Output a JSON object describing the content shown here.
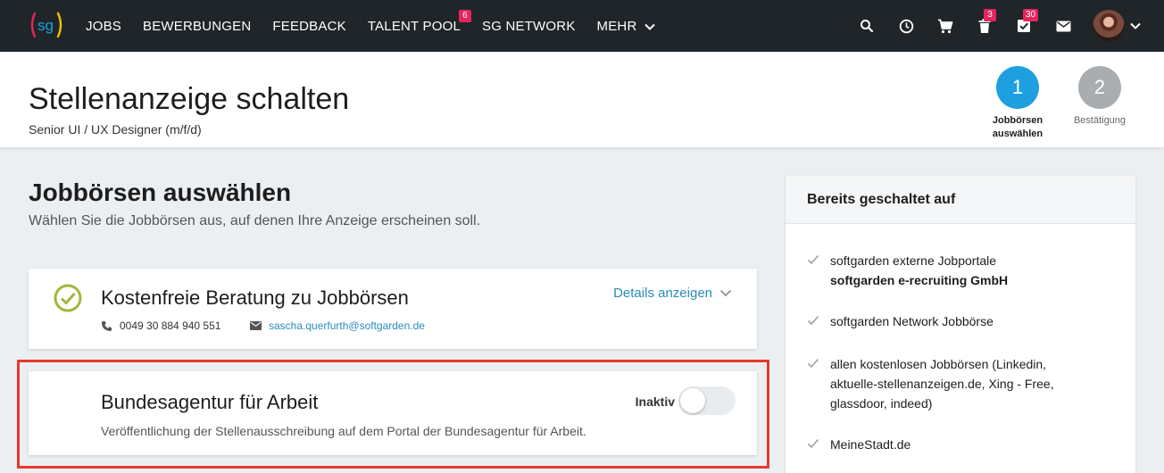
{
  "nav": {
    "logo_text": "sg",
    "links": [
      {
        "label": "JOBS"
      },
      {
        "label": "BEWERBUNGEN"
      },
      {
        "label": "FEEDBACK"
      },
      {
        "label": "TALENT POOL",
        "badge": "6"
      },
      {
        "label": "SG NETWORK"
      },
      {
        "label": "MEHR"
      }
    ],
    "icons": {
      "trash_badge": "3",
      "tasks_badge": "30"
    }
  },
  "header": {
    "title": "Stellenanzeige schalten",
    "subtitle": "Senior UI / UX Designer (m/f/d)",
    "steps": [
      {
        "number": "1",
        "label": "Jobbörsen auswählen"
      },
      {
        "number": "2",
        "label": "Bestätigung"
      }
    ]
  },
  "main": {
    "title": "Jobbörsen auswählen",
    "description": "Wählen Sie die Jobbörsen aus, auf denen Ihre Anzeige erscheinen soll.",
    "consult_card": {
      "title": "Kostenfreie Beratung zu Jobbörsen",
      "details_label": "Details anzeigen",
      "phone": "0049 30 884 940 551",
      "email": "sascha.querfurth@softgarden.de"
    },
    "ba_card": {
      "title": "Bundesagentur für Arbeit",
      "description": "Veröffentlichung der Stellenausschreibung auf dem Portal der Bundesagentur für Arbeit.",
      "toggle_label": "Inaktiv"
    }
  },
  "side": {
    "title": "Bereits geschaltet auf",
    "items": [
      {
        "text": "softgarden externe Jobportale",
        "strong": "softgarden e-recruiting GmbH"
      },
      {
        "text": "softgarden Network Jobbörse"
      },
      {
        "text": "allen kostenlosen Jobbörsen (Linkedin, aktuelle-stellenanzeigen.de, Xing - Free, glassdoor, indeed)"
      },
      {
        "text": "MeineStadt.de"
      }
    ]
  },
  "colors": {
    "nav_bg": "#1f2529",
    "accent_blue": "#1ea0e0",
    "badge": "#e5265c",
    "check_green": "#a4b53a",
    "highlight_red": "#e53a2d"
  }
}
